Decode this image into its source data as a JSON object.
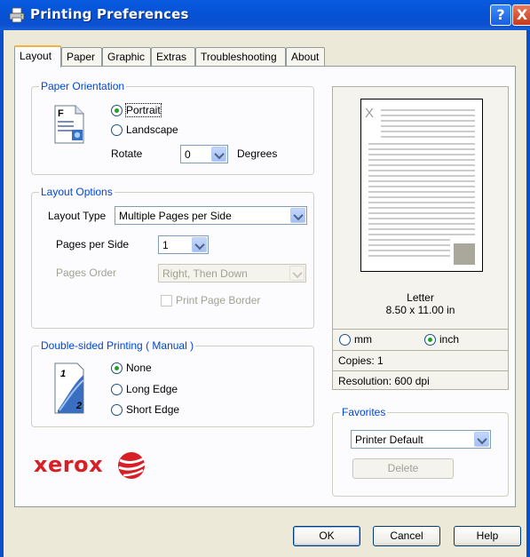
{
  "window": {
    "title": "Printing Preferences",
    "help_label": "?",
    "close_label": "X"
  },
  "tabs": [
    {
      "label": "Layout"
    },
    {
      "label": "Paper"
    },
    {
      "label": "Graphic"
    },
    {
      "label": "Extras"
    },
    {
      "label": "Troubleshooting"
    },
    {
      "label": "About"
    }
  ],
  "orientation": {
    "group_label": "Paper Orientation",
    "portrait": "Portrait",
    "landscape": "Landscape",
    "selected": "Portrait",
    "rotate_label": "Rotate",
    "rotate_value": "0",
    "degrees_label": "Degrees",
    "icon_letter": "F"
  },
  "layout_options": {
    "group_label": "Layout Options",
    "layout_type_label": "Layout Type",
    "layout_type_value": "Multiple Pages per Side",
    "pages_per_side_label": "Pages per Side",
    "pages_per_side_value": "1",
    "pages_order_label": "Pages Order",
    "pages_order_value": "Right, Then Down",
    "border_label": "Print Page Border"
  },
  "duplex": {
    "group_label": "Double-sided Printing ( Manual )",
    "none": "None",
    "long_edge": "Long Edge",
    "short_edge": "Short Edge",
    "selected": "None",
    "icon_front": "1",
    "icon_back": "2"
  },
  "preview": {
    "page_mark": "X",
    "paper_name": "Letter",
    "paper_size": "8.50 x 11.00 in",
    "unit_mm": "mm",
    "unit_inch": "inch",
    "selected_unit": "inch",
    "copies": "Copies: 1",
    "resolution": "Resolution: 600 dpi"
  },
  "favorites": {
    "group_label": "Favorites",
    "value": "Printer Default",
    "delete_label": "Delete"
  },
  "brand": {
    "name": "xerox",
    "color": "#d71f26"
  },
  "buttons": {
    "ok": "OK",
    "cancel": "Cancel",
    "help": "Help"
  },
  "colors": {
    "titlebar": "#0554d6",
    "group_label": "#0046d5",
    "radio_dot": "#21a121"
  }
}
